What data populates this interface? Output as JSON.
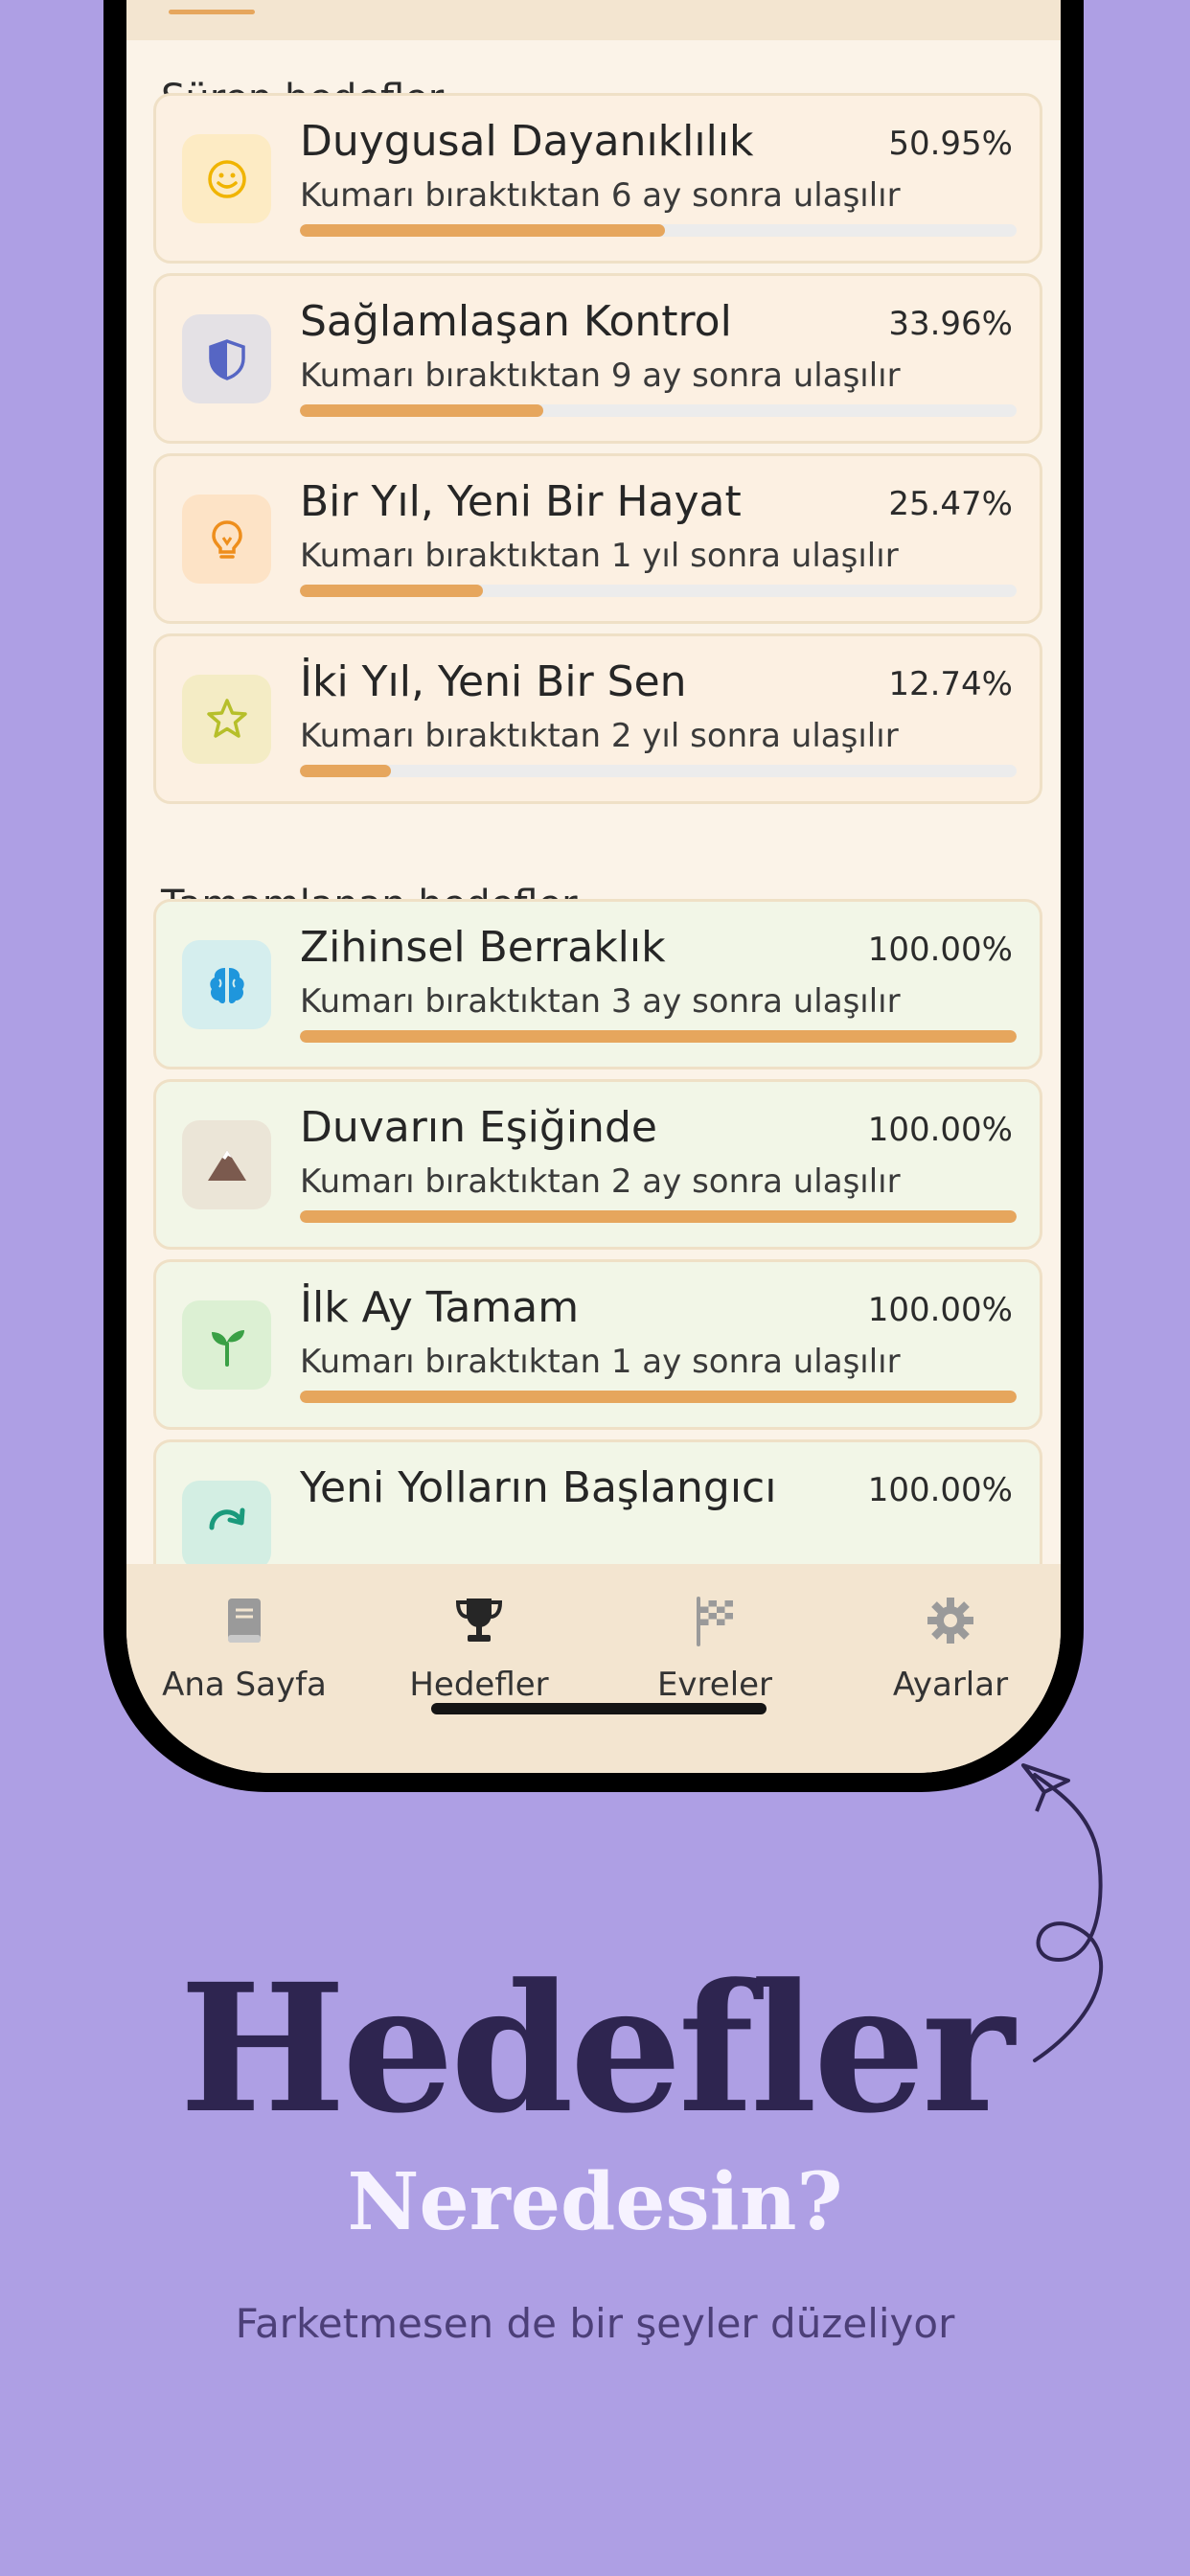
{
  "sections": {
    "ongoing_title": "Süren hedefler",
    "completed_title": "Tamamlanan hedefler"
  },
  "ongoing": [
    {
      "title": "Duygusal Dayanıklılık",
      "subtitle": "Kumarı bıraktıktan 6 ay sonra ulaşılır",
      "percent": "50.95%",
      "progress": 0.5095,
      "icon": "smile-icon",
      "icon_bg": "#fdebc4",
      "icon_color": "#f0b400"
    },
    {
      "title": "Sağlamlaşan Kontrol",
      "subtitle": "Kumarı bıraktıktan 9 ay sonra ulaşılır",
      "percent": "33.96%",
      "progress": 0.3396,
      "icon": "shield-icon",
      "icon_bg": "#e4e1e5",
      "icon_color": "#5666c4"
    },
    {
      "title": "Bir Yıl, Yeni Bir Hayat",
      "subtitle": "Kumarı bıraktıktan 1 yıl sonra ulaşılır",
      "percent": "25.47%",
      "progress": 0.2547,
      "icon": "lightbulb-icon",
      "icon_bg": "#fde3c6",
      "icon_color": "#ee8e1c"
    },
    {
      "title": "İki Yıl, Yeni Bir Sen",
      "subtitle": "Kumarı bıraktıktan 2 yıl sonra ulaşılır",
      "percent": "12.74%",
      "progress": 0.1274,
      "icon": "star-icon",
      "icon_bg": "#f4ecc5",
      "icon_color": "#b6bf2a"
    }
  ],
  "completed": [
    {
      "title": "Zihinsel Berraklık",
      "subtitle": "Kumarı bıraktıktan 3 ay sonra ulaşılır",
      "percent": "100.00%",
      "progress": 1,
      "icon": "brain-icon",
      "icon_bg": "#d5eeee",
      "icon_color": "#1f96dc"
    },
    {
      "title": "Duvarın Eşiğinde",
      "subtitle": "Kumarı bıraktıktan 2 ay sonra ulaşılır",
      "percent": "100.00%",
      "progress": 1,
      "icon": "mountain-icon",
      "icon_bg": "#ebe5d7",
      "icon_color": "#7b5a4e"
    },
    {
      "title": "İlk Ay Tamam",
      "subtitle": "Kumarı bıraktıktan 1 ay sonra ulaşılır",
      "percent": "100.00%",
      "progress": 1,
      "icon": "sprout-icon",
      "icon_bg": "#dcf0d3",
      "icon_color": "#3aa045"
    },
    {
      "title": "Yeni Yolların Başlangıcı",
      "subtitle": "",
      "percent": "100.00%",
      "progress": 1,
      "icon": "refresh-arrow-icon",
      "icon_bg": "#d3eee3",
      "icon_color": "#1a9a7c"
    }
  ],
  "nav": [
    {
      "label": "Ana Sayfa",
      "icon": "book-icon",
      "active": false
    },
    {
      "label": "Hedefler",
      "icon": "trophy-icon",
      "active": true
    },
    {
      "label": "Evreler",
      "icon": "checkered-flag-icon",
      "active": false
    },
    {
      "label": "Ayarlar",
      "icon": "gear-icon",
      "active": false
    }
  ],
  "promo": {
    "headline": "Hedefler",
    "subheadline": "Neredesin?",
    "tagline": "Farketmesen de bir şeyler düzeliyor"
  },
  "colors": {
    "background": "#ae9fe4",
    "accent": "#e6a65d",
    "headline": "#2e2550"
  }
}
